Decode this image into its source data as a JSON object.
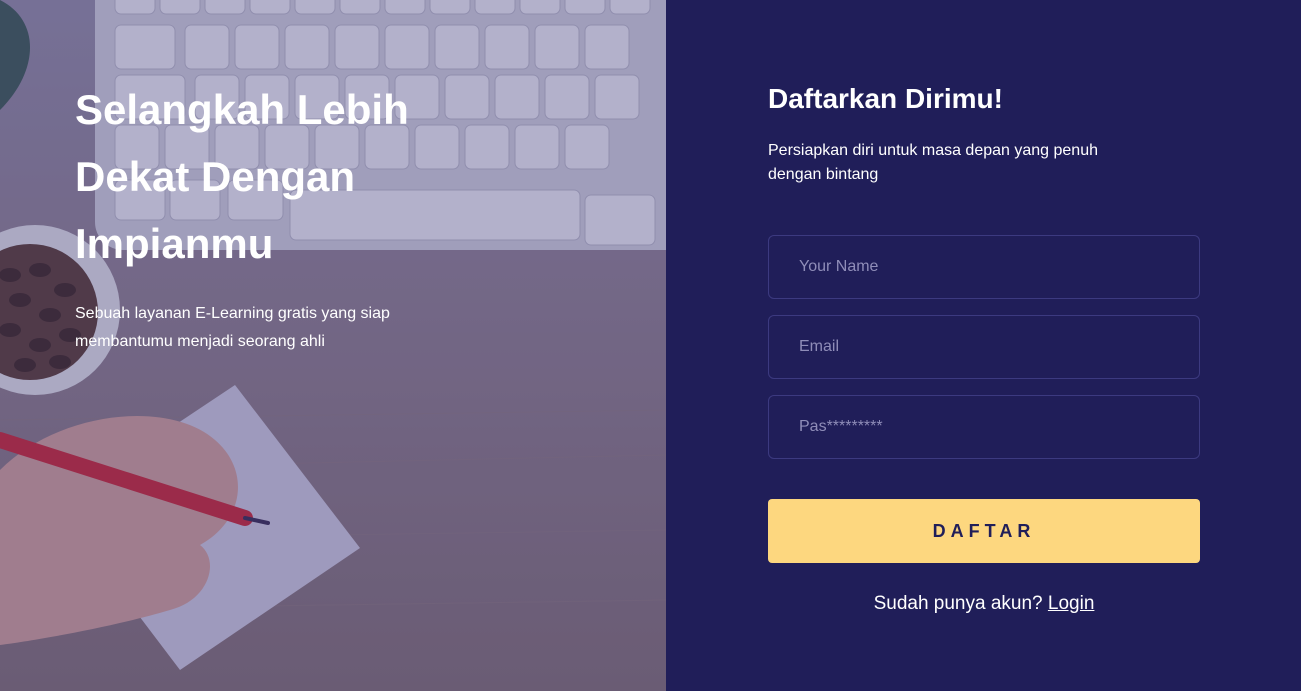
{
  "hero": {
    "title_line1": "Selangkah Lebih",
    "title_line2": "Dekat Dengan",
    "title_line3": "Impianmu",
    "subtitle_line1": "Sebuah layanan E-Learning gratis yang siap",
    "subtitle_line2": "membantumu menjadi seorang ahli"
  },
  "form": {
    "title": "Daftarkan Dirimu!",
    "subtitle_line1": "Persiapkan diri untuk masa depan yang penuh",
    "subtitle_line2": "dengan bintang",
    "name_placeholder": "Your Name",
    "email_placeholder": "Email",
    "password_placeholder": "Pas*********",
    "submit_label": "DAFTAR",
    "login_prompt": "Sudah punya akun?",
    "login_link": "Login"
  },
  "colors": {
    "panel_bg": "#201e59",
    "button_bg": "#fdd77f",
    "field_border": "#3c3a80"
  }
}
